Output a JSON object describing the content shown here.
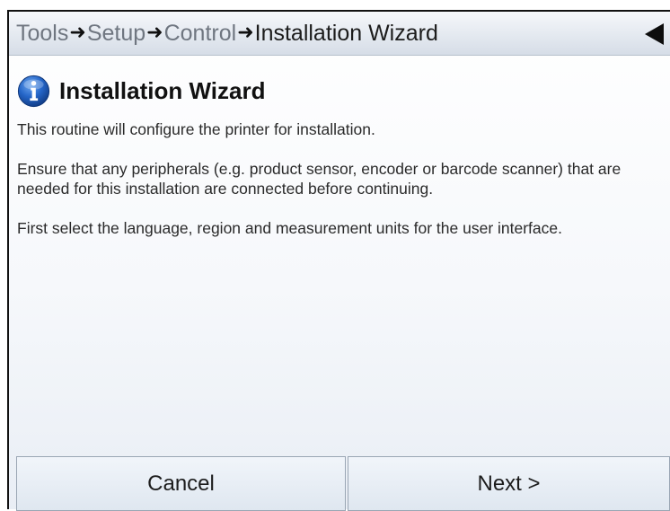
{
  "breadcrumb": {
    "items": [
      "Tools",
      "Setup",
      "Control",
      "Installation Wizard"
    ],
    "separator": "➜"
  },
  "icons": {
    "back": "triangle-left-icon",
    "info": "info-circle-icon"
  },
  "colors": {
    "info_blue": "#1f63c4",
    "header_bg": "#e4e9f0",
    "button_bg": "#e6edf5"
  },
  "main": {
    "title": "Installation Wizard",
    "paragraphs": [
      "This routine will configure the printer for installation.",
      "Ensure that any peripherals (e.g. product sensor, encoder or barcode scanner) that are needed for this installation are connected before continuing.",
      "First select the language, region and measurement units for the user interface."
    ]
  },
  "footer": {
    "cancel_label": "Cancel",
    "next_label": "Next >"
  }
}
